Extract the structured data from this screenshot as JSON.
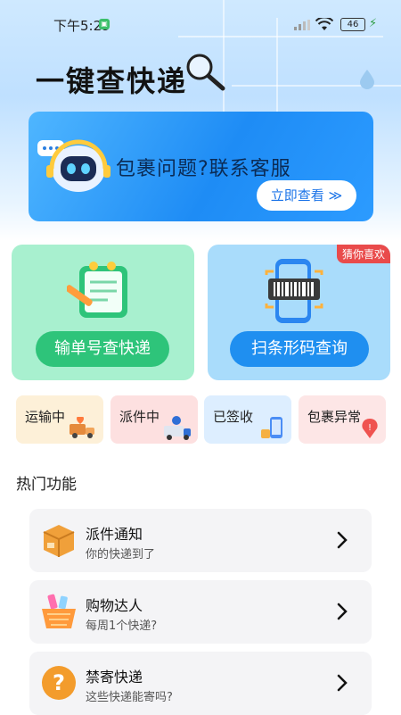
{
  "status_bar": {
    "time": "下午5:29",
    "battery": "46"
  },
  "header": {
    "title": "一键查快递"
  },
  "banner": {
    "title": "包裹问题?联系客服",
    "cta": "立即查看 ≫"
  },
  "cards": [
    {
      "label": "输单号查快递",
      "color": "#2ec47a"
    },
    {
      "label": "扫条形码查询",
      "color": "#1f8ff0",
      "tag": "猜你喜欢"
    }
  ],
  "statuses": [
    {
      "label": "运输中"
    },
    {
      "label": "派件中"
    },
    {
      "label": "已签收"
    },
    {
      "label": "包裹异常"
    }
  ],
  "section": {
    "title": "热门功能"
  },
  "features": [
    {
      "name": "派件通知",
      "desc": "你的快递到了",
      "icon": "package-icon"
    },
    {
      "name": "购物达人",
      "desc": "每周1个快递?",
      "icon": "shopping-basket-icon"
    },
    {
      "name": "禁寄快递",
      "desc": "这些快递能寄吗?",
      "icon": "question-icon"
    }
  ]
}
